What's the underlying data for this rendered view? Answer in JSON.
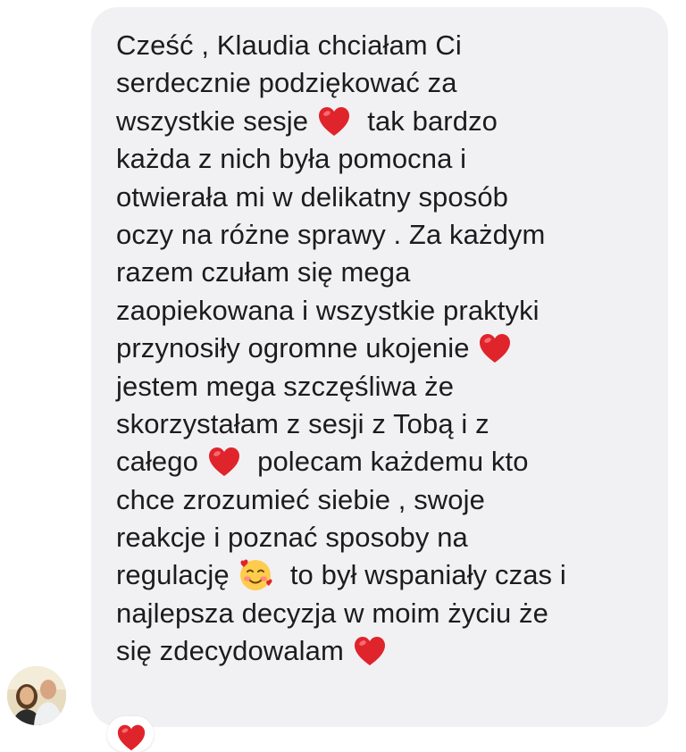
{
  "conversation": {
    "message": {
      "lines": [
        [
          "Cześć , Klaudia chciałam Ci"
        ],
        [
          "serdecznie podziękować za"
        ],
        [
          "wszystkie sesje ",
          {
            "emoji": "❤️"
          },
          "  tak bardzo"
        ],
        [
          "każda z nich była pomocna i"
        ],
        [
          "otwierała mi w delikatny sposób"
        ],
        [
          "oczy na różne sprawy . Za każdym"
        ],
        [
          "razem czułam się mega"
        ],
        [
          "zaopiekowana i wszystkie praktyki"
        ],
        [
          "przynosiły ogromne ukojenie ",
          {
            "emoji": "❤️"
          }
        ],
        [
          "jestem mega szczęśliwa że"
        ],
        [
          "skorzystałam z sesji z Tobą i z"
        ],
        [
          "całego ",
          {
            "emoji": "❤️"
          },
          "  polecam każdemu kto"
        ],
        [
          "chce zrozumieć siebie , swoje"
        ],
        [
          "reakcje i poznać sposoby na"
        ],
        [
          "regulację ",
          {
            "emoji": "🥰"
          },
          "  to był wspaniały czas i"
        ],
        [
          "najlepsza decyzja w moim życiu że"
        ],
        [
          "się zdecydowalam ",
          {
            "emoji": "❤️"
          }
        ]
      ]
    },
    "reaction": {
      "emoji": "❤️"
    },
    "sender": {
      "avatar_icon": "user-avatar-icon"
    }
  },
  "colors": {
    "bubble_bg": "#f1f1f4",
    "text": "#1c1c1e",
    "heart": "#e0242c",
    "page_bg": "#ffffff"
  }
}
